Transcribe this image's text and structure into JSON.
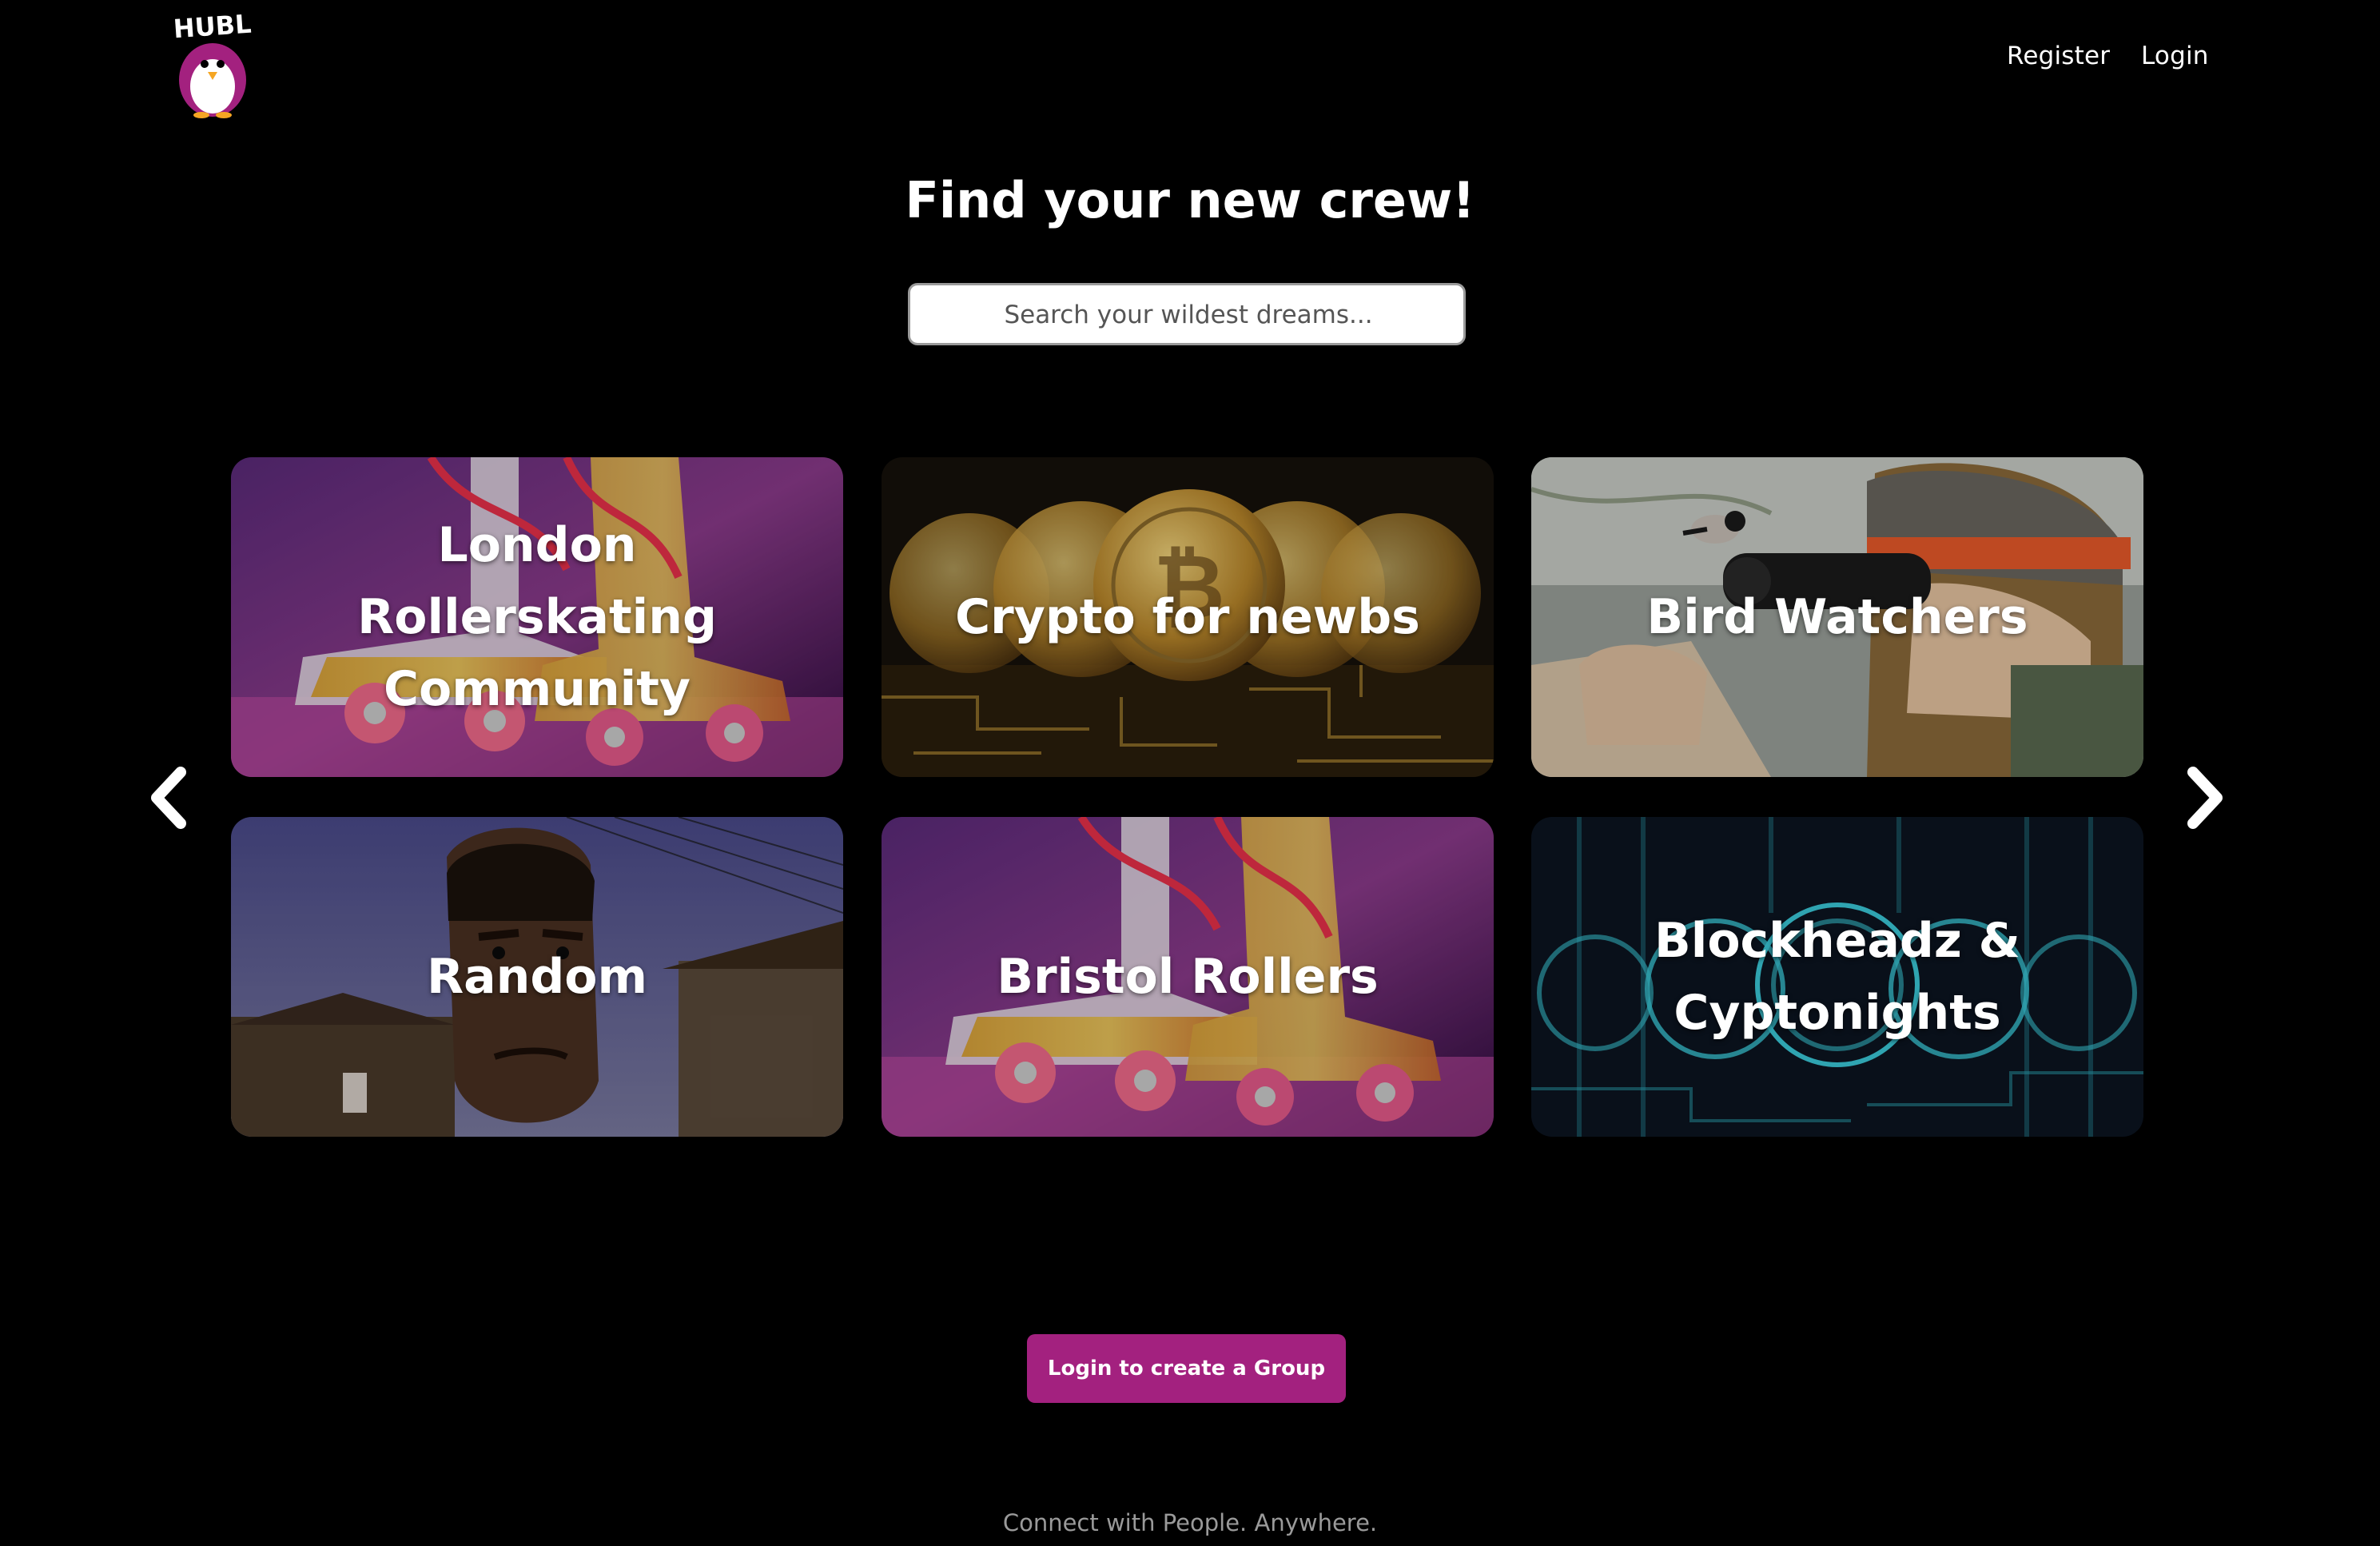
{
  "brand": {
    "logo_text": "HUBL",
    "accent_color": "#a3217f"
  },
  "nav": {
    "register_label": "Register",
    "login_label": "Login"
  },
  "hero": {
    "title": "Find your new crew!",
    "search_placeholder": "Search your wildest dreams..."
  },
  "carousel": {
    "prev_icon": "chevron-left-icon",
    "next_icon": "chevron-right-icon",
    "groups": [
      {
        "name": "London Rollerskating Community",
        "image": "roller-skates"
      },
      {
        "name": "Crypto for newbs",
        "image": "bitcoin-coins"
      },
      {
        "name": "Bird Watchers",
        "image": "binoculars-bird"
      },
      {
        "name": "Random",
        "image": "game-character-face"
      },
      {
        "name": "Bristol Rollers",
        "image": "roller-skates"
      },
      {
        "name": "Blockheadz & Cyptonights",
        "image": "crypto-coins-neon"
      }
    ]
  },
  "cta": {
    "label": "Login to create a Group"
  },
  "footer": {
    "tagline": "Connect with People. Anywhere."
  }
}
